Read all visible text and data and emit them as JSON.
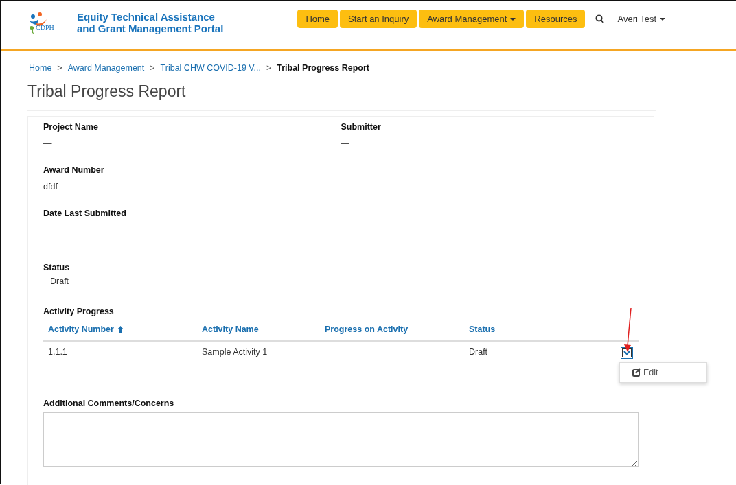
{
  "header": {
    "logo_text": "CDPH",
    "portal_title": [
      "Equity Technical Assistance",
      "and Grant Management Portal"
    ],
    "nav": [
      {
        "label": "Home",
        "dropdown": false
      },
      {
        "label": "Start an Inquiry",
        "dropdown": false
      },
      {
        "label": "Award Management",
        "dropdown": true
      },
      {
        "label": "Resources",
        "dropdown": false
      }
    ],
    "user": {
      "label": "Averi Test",
      "dropdown": true
    }
  },
  "breadcrumb": [
    {
      "label": "Home",
      "current": false
    },
    {
      "separator": ">",
      "label": "Award Management",
      "current": false
    },
    {
      "separator": ">",
      "label": "Tribal CHW COVID-19 V...",
      "current": false
    },
    {
      "separator": ">",
      "label": "Tribal Progress Report",
      "current": true
    }
  ],
  "page_title": "Tribal Progress Report",
  "field_rows": [
    [
      {
        "label": "Project Name",
        "value": "—"
      },
      {
        "label": "Submitter",
        "value": "—"
      }
    ],
    [
      {
        "label": "Award Number",
        "value": "dfdf"
      }
    ],
    [
      {
        "label": "Date Last Submitted",
        "value": "—"
      }
    ]
  ],
  "status": {
    "label": "Status",
    "value": "Draft"
  },
  "activity_progress": {
    "title": "Activity Progress",
    "columns": [
      {
        "label": "Activity Number",
        "sorted": true
      },
      {
        "label": "Activity Name",
        "sorted": false
      },
      {
        "label": "Progress on Activity",
        "sorted": false
      },
      {
        "label": "Status",
        "sorted": false
      }
    ],
    "rows": [
      {
        "cells": [
          "1.1.1",
          "Sample Activity 1",
          "",
          "Draft"
        ],
        "menu_open": true,
        "menu_items": [
          "Edit"
        ]
      }
    ]
  },
  "comments": {
    "label": "Additional Comments/Concerns"
  }
}
